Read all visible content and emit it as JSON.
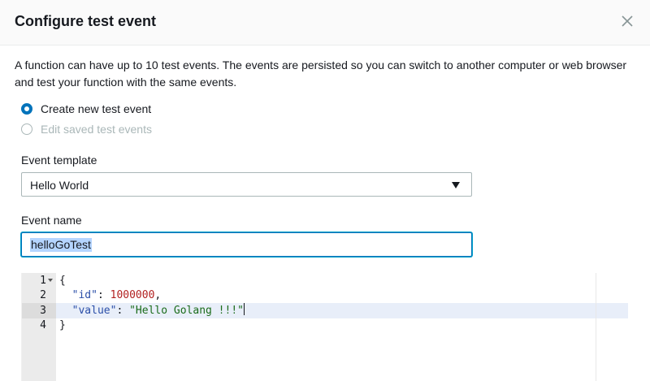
{
  "modal": {
    "title": "Configure test event",
    "close_icon": "close-icon"
  },
  "description": "A function can have up to 10 test events. The events are persisted so you can switch to another computer or web browser and test your function with the same events.",
  "options": {
    "create_new": {
      "label": "Create new test event",
      "selected": true
    },
    "edit_saved": {
      "label": "Edit saved test events",
      "selected": false,
      "disabled": true
    }
  },
  "event_template": {
    "label": "Event template",
    "value": "Hello World"
  },
  "event_name": {
    "label": "Event name",
    "value": "helloGoTest"
  },
  "editor": {
    "line_numbers": [
      "1",
      "2",
      "3",
      "4"
    ],
    "lines": [
      {
        "tokens": [
          {
            "t": "{",
            "c": ""
          }
        ]
      },
      {
        "tokens": [
          {
            "t": "  ",
            "c": ""
          },
          {
            "t": "\"id\"",
            "c": "tok-key"
          },
          {
            "t": ": ",
            "c": ""
          },
          {
            "t": "1000000",
            "c": "tok-num"
          },
          {
            "t": ",",
            "c": ""
          }
        ]
      },
      {
        "tokens": [
          {
            "t": "  ",
            "c": ""
          },
          {
            "t": "\"value\"",
            "c": "tok-key"
          },
          {
            "t": ": ",
            "c": ""
          },
          {
            "t": "\"Hello Golang !!!\"",
            "c": "tok-str"
          }
        ]
      },
      {
        "tokens": [
          {
            "t": "}",
            "c": ""
          }
        ]
      }
    ],
    "active_line": 3,
    "colors": {
      "key": "#2a4ea8",
      "number": "#b22222",
      "string": "#1a6b1a",
      "accent": "#0073bb"
    }
  }
}
